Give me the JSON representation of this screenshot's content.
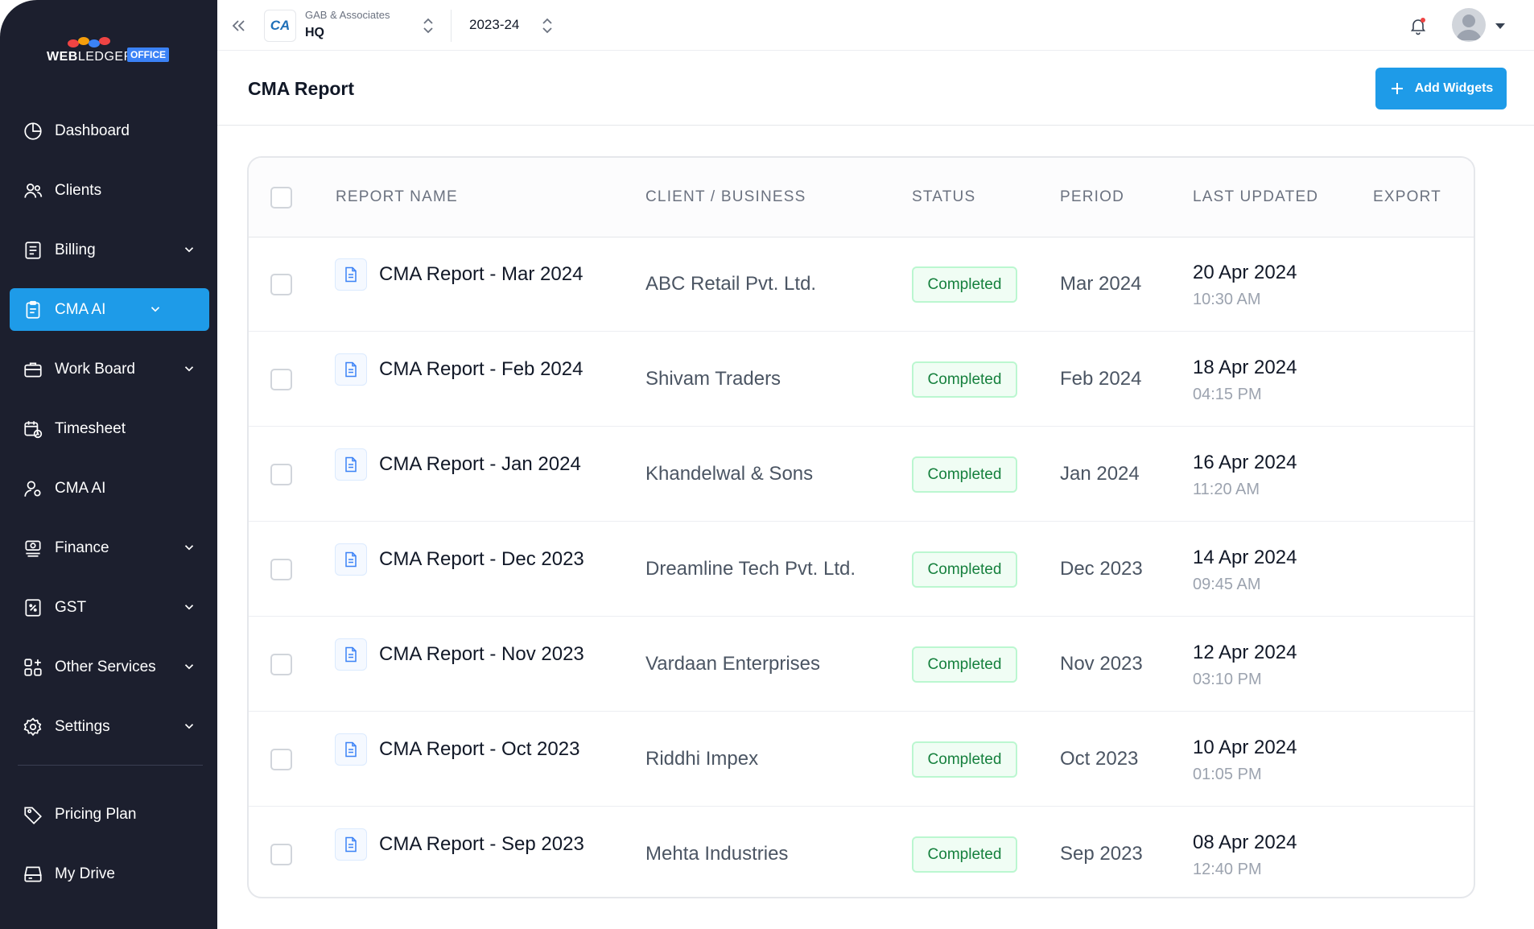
{
  "brand": {
    "logo_text_bold": "WEB",
    "logo_text_light": "LEDGER",
    "logo_badge": "OFFICE"
  },
  "sidebar": {
    "items": [
      {
        "label": "Dashboard",
        "icon": "pie-chart-icon",
        "has_chevron": false,
        "active": false
      },
      {
        "label": "Clients",
        "icon": "users-icon",
        "has_chevron": false,
        "active": false
      },
      {
        "label": "Billing",
        "icon": "invoice-icon",
        "has_chevron": true,
        "active": false
      },
      {
        "label": "CMA AI",
        "icon": "clipboard-icon",
        "has_chevron": true,
        "active": true
      },
      {
        "label": "Work Board",
        "icon": "briefcase-icon",
        "has_chevron": true,
        "active": false
      },
      {
        "label": "Timesheet",
        "icon": "calendar-clock-icon",
        "has_chevron": false,
        "active": false
      },
      {
        "label": "CMA AI",
        "icon": "user-gear-icon",
        "has_chevron": false,
        "active": false
      },
      {
        "label": "Finance",
        "icon": "finance-icon",
        "has_chevron": true,
        "active": false
      },
      {
        "label": "GST",
        "icon": "gst-icon",
        "has_chevron": true,
        "active": false
      },
      {
        "label": "Other Services",
        "icon": "grid-plus-icon",
        "has_chevron": true,
        "active": false
      },
      {
        "label": "Settings",
        "icon": "gear-icon",
        "has_chevron": true,
        "active": false
      }
    ],
    "bottom_items": [
      {
        "label": "Pricing Plan",
        "icon": "tag-icon"
      },
      {
        "label": "My Drive",
        "icon": "drive-icon"
      }
    ]
  },
  "topbar": {
    "firm_logo_text": "CA",
    "firm_name": "GAB & Associates",
    "firm_branch": "HQ",
    "year": "2023-24"
  },
  "page": {
    "title": "CMA Report",
    "add_button": "Add Widgets"
  },
  "table": {
    "columns": [
      "REPORT NAME",
      "CLIENT / BUSINESS",
      "STATUS",
      "PERIOD",
      "LAST UPDATED",
      "EXPORT"
    ],
    "rows": [
      {
        "name": "CMA Report - Mar 2024",
        "client": "ABC Retail Pvt. Ltd.",
        "status": "Completed",
        "period": "Mar 2024",
        "date": "20 Apr 2024",
        "time": "10:30 AM"
      },
      {
        "name": "CMA Report - Feb 2024",
        "client": "Shivam Traders",
        "status": "Completed",
        "period": "Feb 2024",
        "date": "18 Apr 2024",
        "time": "04:15 PM"
      },
      {
        "name": "CMA Report - Jan 2024",
        "client": "Khandelwal & Sons",
        "status": "Completed",
        "period": "Jan 2024",
        "date": "16 Apr 2024",
        "time": "11:20 AM"
      },
      {
        "name": "CMA Report - Dec 2023",
        "client": "Dreamline Tech Pvt. Ltd.",
        "status": "Completed",
        "period": "Dec 2023",
        "date": "14 Apr 2024",
        "time": "09:45 AM"
      },
      {
        "name": "CMA Report - Nov 2023",
        "client": "Vardaan Enterprises",
        "status": "Completed",
        "period": "Nov 2023",
        "date": "12 Apr 2024",
        "time": "03:10 PM"
      },
      {
        "name": "CMA Report - Oct 2023",
        "client": "Riddhi Impex",
        "status": "Completed",
        "period": "Oct 2023",
        "date": "10 Apr 2024",
        "time": "01:05 PM"
      },
      {
        "name": "CMA Report - Sep 2023",
        "client": "Mehta Industries",
        "status": "Completed",
        "period": "Sep 2023",
        "date": "08 Apr 2024",
        "time": "12:40 PM"
      }
    ]
  },
  "colors": {
    "sidebar_bg": "#1c1f2e",
    "accent": "#1e9be8",
    "status_green": "#15803d",
    "notification_dot": "#ef4444"
  }
}
